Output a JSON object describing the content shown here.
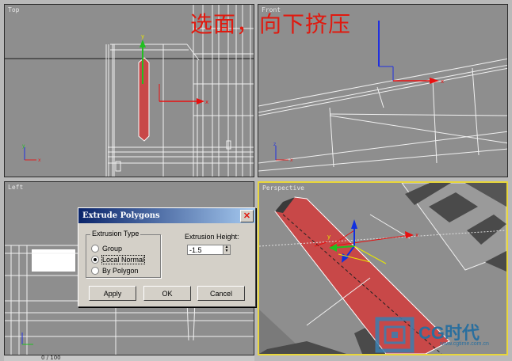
{
  "annotation": "选面，向下挤压",
  "viewports": {
    "top": "Top",
    "front": "Front",
    "left": "Left",
    "perspective": "Perspective"
  },
  "dialog": {
    "title": "Extrude Polygons",
    "close_label": "✕",
    "extrusion_type_label": "Extrusion Type",
    "options": [
      "Group",
      "Local Normal",
      "By Polygon"
    ],
    "selected_option": "Local Normal",
    "extrusion_height_label": "Extrusion Height:",
    "extrusion_height_value": "-1.5",
    "apply_label": "Apply",
    "ok_label": "OK",
    "cancel_label": "Cancel"
  },
  "status": "0 / 100",
  "logo": {
    "text": "CG时代",
    "url": "www.cgtime.com.cn"
  },
  "colors": {
    "selection": "#c84848",
    "gizmo_x": "#e81010",
    "gizmo_y": "#20c020",
    "gizmo_z": "#1030e0",
    "active_border": "#e8d63a",
    "annotation": "#e0190f"
  }
}
